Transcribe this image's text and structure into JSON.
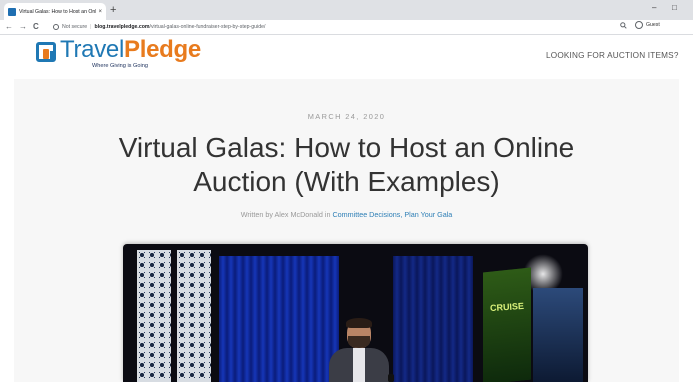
{
  "browser": {
    "tab_title": "Virtual Galas: How to Host an Onl",
    "tab_close": "×",
    "new_tab": "+",
    "nav_back": "←",
    "nav_forward": "→",
    "nav_reload": "C",
    "security_label": "Not secure",
    "url_host": "blog.travelpledge.com",
    "url_path": "/virtual-galas-online-fundraiser-step-by-step-guide/",
    "profile_label": "Guest",
    "window_minimize": "–",
    "window_restore": "□"
  },
  "site": {
    "logo_travel": "Travel",
    "logo_pledge": "Pledge",
    "logo_tagline": "Where Giving is Going",
    "nav_link": "LOOKING FOR AUCTION ITEMS?"
  },
  "article": {
    "date": "MARCH 24, 2020",
    "title": "Virtual Galas: How to Host an Online Auction (With Examples)",
    "byline_prefix": "Written by Alex McDonald in",
    "categories": "Committee Decisions, Plan Your Gala"
  },
  "hero": {
    "screen_text": "CRUISE"
  },
  "colors": {
    "brand_blue": "#1f78b4",
    "brand_orange": "#e87b1e",
    "link_blue": "#2e7fb6"
  }
}
